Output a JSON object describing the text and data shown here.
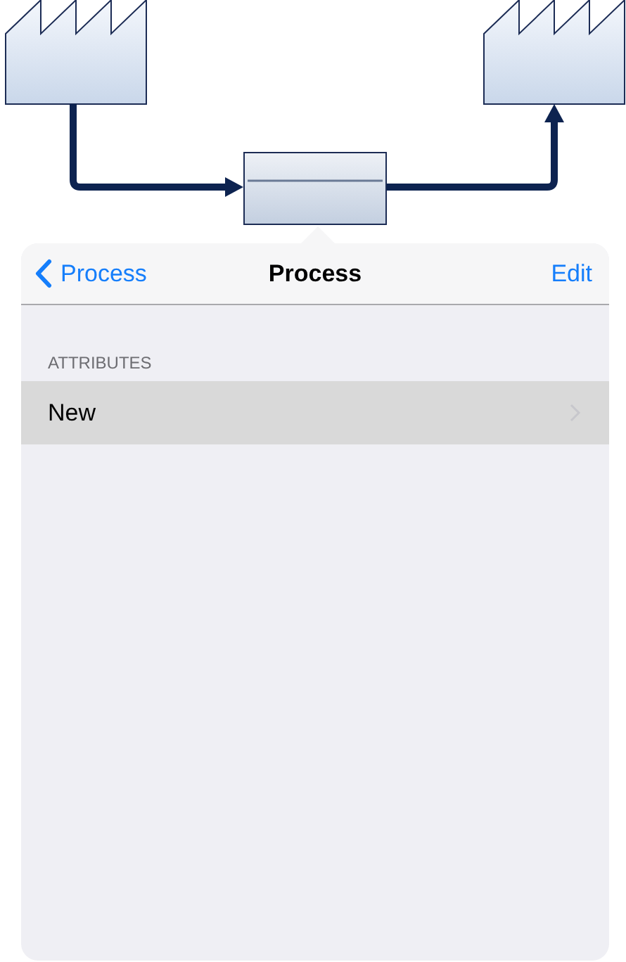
{
  "navigation_bar": {
    "back_label": "Process",
    "title": "Process",
    "action": "Edit"
  },
  "section": {
    "header": "ATTRIBUTES",
    "rows": [
      {
        "label": "New",
        "selected": true
      }
    ]
  }
}
